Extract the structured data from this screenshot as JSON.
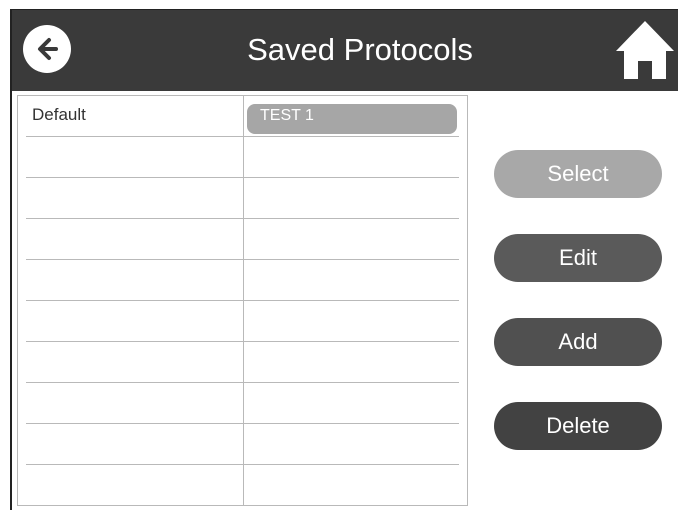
{
  "header": {
    "title": "Saved Protocols",
    "back_icon": "arrow-left-icon",
    "home_icon": "home-icon",
    "background": "#3a3a3a"
  },
  "table": {
    "rows": [
      {
        "col1": "Default",
        "col2": "TEST 1",
        "selected": true
      },
      {
        "col1": "",
        "col2": ""
      },
      {
        "col1": "",
        "col2": ""
      },
      {
        "col1": "",
        "col2": ""
      },
      {
        "col1": "",
        "col2": ""
      },
      {
        "col1": "",
        "col2": ""
      },
      {
        "col1": "",
        "col2": ""
      },
      {
        "col1": "",
        "col2": ""
      },
      {
        "col1": "",
        "col2": ""
      },
      {
        "col1": "",
        "col2": ""
      }
    ]
  },
  "actions": {
    "select": {
      "label": "Select",
      "color": "#a8a8a8"
    },
    "edit": {
      "label": "Edit",
      "color": "#5a5a5a"
    },
    "add": {
      "label": "Add",
      "color": "#505050"
    },
    "delete": {
      "label": "Delete",
      "color": "#424242"
    }
  }
}
